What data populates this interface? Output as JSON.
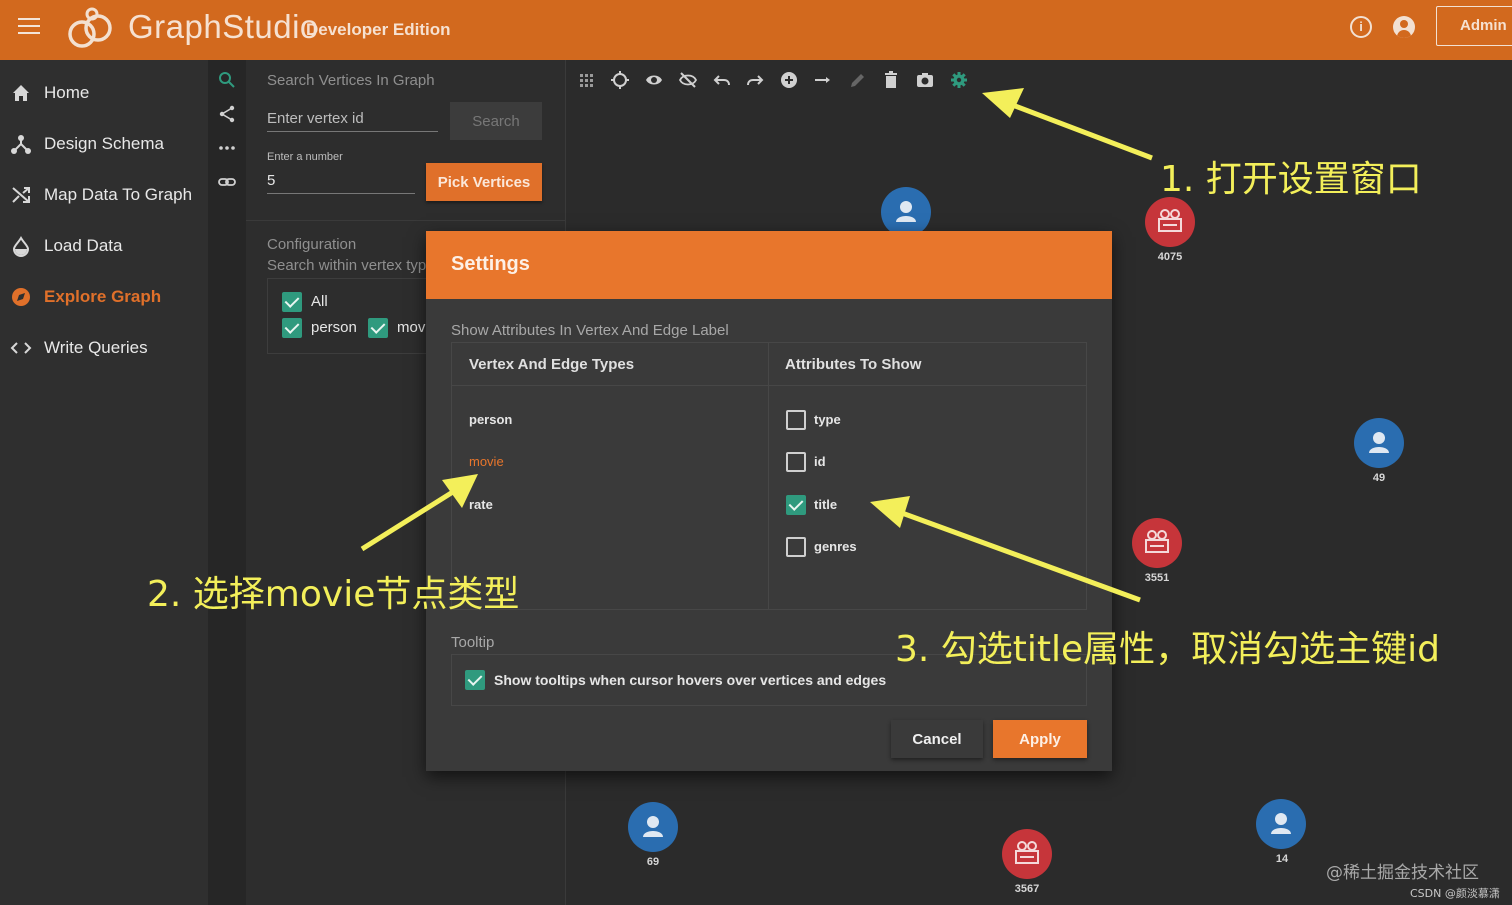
{
  "header": {
    "brand_graph": "Graph",
    "brand_studio": "Studio",
    "edition": "Developer Edition",
    "admin_label": "Admin",
    "info_glyph": "i",
    "accent_color": "#d2691e"
  },
  "nav": {
    "items": [
      {
        "label": "Home",
        "icon": "home-icon"
      },
      {
        "label": "Design Schema",
        "icon": "schema-icon"
      },
      {
        "label": "Map Data To Graph",
        "icon": "shuffle-icon"
      },
      {
        "label": "Load Data",
        "icon": "drop-icon"
      },
      {
        "label": "Explore Graph",
        "icon": "compass-icon",
        "active": true
      },
      {
        "label": "Write Queries",
        "icon": "code-icon"
      }
    ]
  },
  "search_panel": {
    "title": "Search Vertices In Graph",
    "vertex_placeholder": "Enter vertex id",
    "search_label": "Search",
    "number_label": "Enter a number",
    "number_value": "5",
    "pick_label": "Pick Vertices",
    "config_title": "Configuration",
    "config_subtitle": "Search within vertex typ",
    "checkbox_all": "All",
    "checkbox_person": "person",
    "checkbox_movie": "mov"
  },
  "graph": {
    "vertices": [
      {
        "label": "",
        "type": "person"
      },
      {
        "label": "4075",
        "type": "movie"
      },
      {
        "label": "49",
        "type": "person"
      },
      {
        "label": "3551",
        "type": "movie"
      },
      {
        "label": "69",
        "type": "person"
      },
      {
        "label": "3567",
        "type": "movie"
      },
      {
        "label": "14",
        "type": "person"
      }
    ]
  },
  "settings": {
    "title": "Settings",
    "section_label": "Show Attributes In Vertex And Edge Label",
    "col_types": "Vertex And Edge Types",
    "col_attrs": "Attributes To Show",
    "types": [
      "person",
      "movie",
      "rate"
    ],
    "selected_type": "movie",
    "attributes": [
      {
        "label": "type",
        "checked": false
      },
      {
        "label": "id",
        "checked": false
      },
      {
        "label": "title",
        "checked": true
      },
      {
        "label": "genres",
        "checked": false
      }
    ],
    "tooltip_label": "Tooltip",
    "tooltip_text": "Show tooltips when cursor hovers over vertices and edges",
    "tooltip_checked": true,
    "cancel_label": "Cancel",
    "apply_label": "Apply"
  },
  "annotations": {
    "step1": "1. 打开设置窗口",
    "step2": "2. 选择movie节点类型",
    "step3": "3. 勾选title属性，取消勾选主键id",
    "arrow_color": "#f3ef5a"
  },
  "watermark": {
    "main": "@稀土掘金技术社区",
    "sub": "CSDN @颜淡慕潇"
  }
}
